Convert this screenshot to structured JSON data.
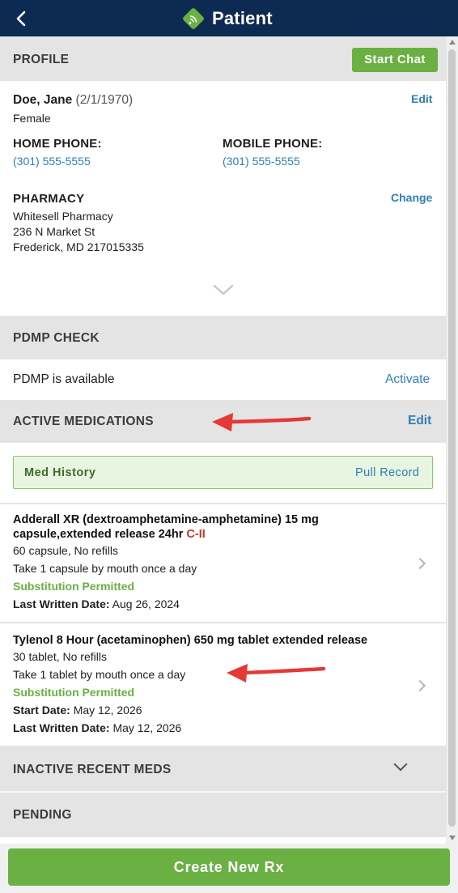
{
  "header": {
    "title": "Patient",
    "back_icon": "chevron-left-icon",
    "logo_icon": "app-logo-icon"
  },
  "profile": {
    "section_title": "PROFILE",
    "start_chat_label": "Start Chat",
    "patient_name": "Doe, Jane",
    "dob": "(2/1/1970)",
    "gender": "Female",
    "edit_label": "Edit",
    "home_phone_label": "HOME PHONE:",
    "home_phone": "(301) 555-5555",
    "mobile_phone_label": "MOBILE PHONE:",
    "mobile_phone": "(301) 555-5555",
    "pharmacy_label": "PHARMACY",
    "pharmacy_change_label": "Change",
    "pharmacy_name": "Whitesell Pharmacy",
    "pharmacy_street": "236 N Market St",
    "pharmacy_city": "Frederick, MD 217015335"
  },
  "pdmp": {
    "section_title": "PDMP CHECK",
    "status_text": "PDMP is available",
    "activate_label": "Activate"
  },
  "active_meds": {
    "section_title": "ACTIVE MEDICATIONS",
    "edit_label": "Edit",
    "med_history_label": "Med History",
    "pull_record_label": "Pull Record",
    "items": [
      {
        "name": "Adderall XR (dextroamphetamine-amphetamine) 15 mg capsule,extended release 24hr",
        "schedule": "C-II",
        "quantity": "60 capsule, No refills",
        "sig": "Take 1 capsule by mouth once a day",
        "substitution": "Substitution Permitted",
        "last_written_label": "Last Written Date:",
        "last_written": "Aug 26, 2024"
      },
      {
        "name": "Tylenol 8 Hour (acetaminophen) 650 mg tablet extended release",
        "quantity": "30 tablet, No refills",
        "sig": "Take 1 tablet by mouth once a day",
        "substitution": "Substitution Permitted",
        "start_label": "Start Date:",
        "start_date": "May 12, 2026",
        "last_written_label": "Last Written Date:",
        "last_written": "May 12, 2026"
      }
    ]
  },
  "inactive_meds": {
    "section_title": "INACTIVE RECENT MEDS"
  },
  "pending": {
    "section_title": "PENDING"
  },
  "footer": {
    "create_rx_label": "Create New Rx"
  },
  "colors": {
    "header_bg": "#0d2a52",
    "accent_green": "#6ab043",
    "link_blue": "#2f7fb5",
    "section_gray": "#e4e4e4",
    "schedule_red": "#c0392b",
    "annotation_arrow": "#e53935"
  }
}
